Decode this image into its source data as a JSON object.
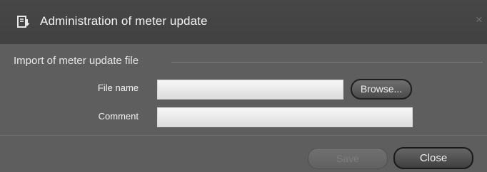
{
  "dialog": {
    "title": "Administration of meter update",
    "title_icon": "document-import-icon",
    "close_icon": "×"
  },
  "section": {
    "title": "Import of meter update file"
  },
  "fields": {
    "file_name_label": "File name",
    "file_name_value": "",
    "comment_label": "Comment",
    "comment_value": ""
  },
  "buttons": {
    "browse": "Browse...",
    "save": "Save",
    "close": "Close"
  },
  "colors": {
    "background": "#5e5e5e",
    "titlebar": "#444444",
    "text": "#f2f2f2",
    "disabled_text": "#7d7d7d"
  }
}
